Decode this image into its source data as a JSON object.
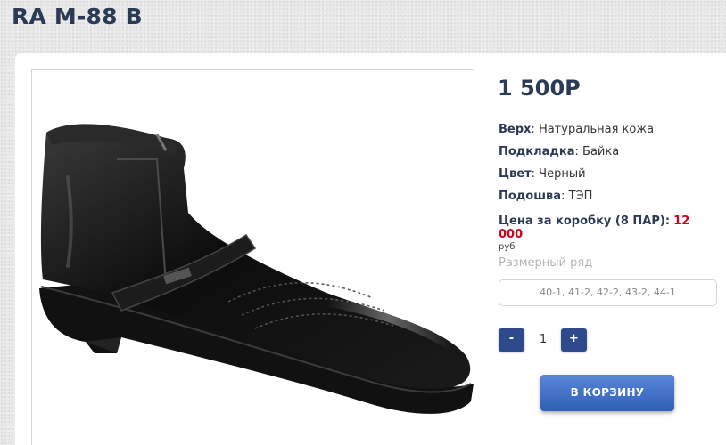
{
  "product": {
    "title": "RA M-88 B",
    "price": "1 500Р",
    "specs": [
      {
        "label": "Верх",
        "value": "Натуральная кожа"
      },
      {
        "label": "Подкладка",
        "value": "Байка"
      },
      {
        "label": "Цвет",
        "value": "Черный"
      },
      {
        "label": "Подошва",
        "value": "ТЭП"
      }
    ],
    "box_price_label": "Цена за коробку (8 ПАР):",
    "box_price_value": "12 000",
    "box_price_unit": "руб",
    "size_label": "Размерный ряд",
    "size_value": "40-1, 41-2, 42-2, 43-2, 44-1",
    "quantity": "1",
    "minus_label": "-",
    "plus_label": "+",
    "cart_button": "В КОРЗИНУ"
  },
  "colors": {
    "title": "#2b3a55",
    "accent_red": "#d0021b",
    "button_blue": "#2c4a8c",
    "cart_blue": "#3f6ec6"
  }
}
